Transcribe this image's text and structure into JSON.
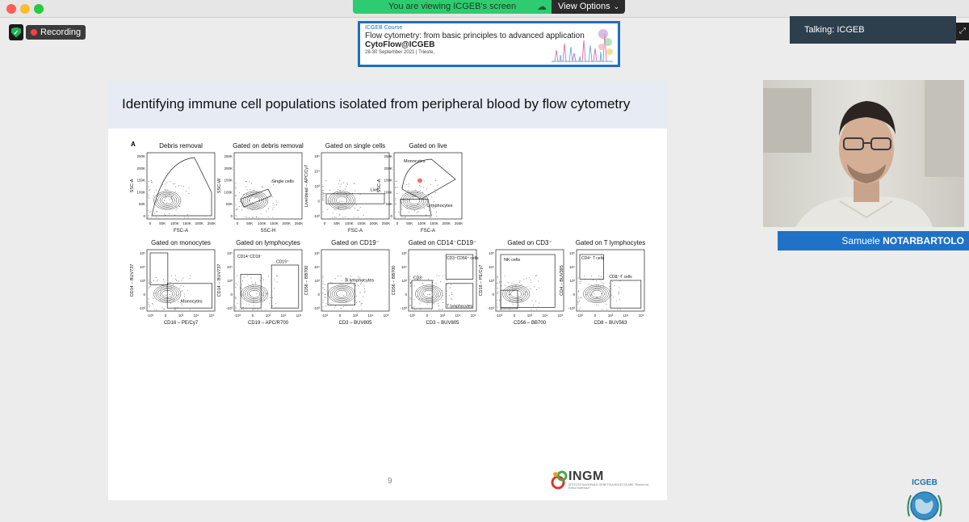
{
  "banner": {
    "viewing_text": "You are viewing ICGEB's screen",
    "view_options_label": "View Options"
  },
  "recording": {
    "label": "Recording"
  },
  "course_logo": {
    "line1": "ICGEB Course",
    "line2": "Flow cytometry: from basic principles to advanced application",
    "line3": "CytoFlow@ICGEB",
    "line4": "28-30 September 2021 | Trieste,"
  },
  "talking": {
    "label": "Talking: ICGEB"
  },
  "slide": {
    "title": "Identifying immune cell populations isolated from peripheral blood by flow cytometry",
    "page_number": "9",
    "logo_text": "INGM",
    "logo_subtext": "ISTITUTO NAZIONALE GENETICA MOLECOLARE \"Romeo ed Enrica Invernizzi\"",
    "figure": {
      "panel_letter": "A",
      "row1": [
        {
          "title": "Debris removal",
          "xlabel": "FSC-A",
          "ylabel": "SSC-A",
          "yticks": [
            "250K",
            "200K",
            "150K",
            "100K",
            "50K",
            "0"
          ],
          "xticks": [
            "0",
            "50K",
            "100K",
            "150K",
            "200K",
            "250K"
          ],
          "gate": ""
        },
        {
          "title": "Gated on debris removal",
          "xlabel": "SSC-H",
          "ylabel": "SSC-W",
          "yticks": [
            "250K",
            "200K",
            "150K",
            "100K",
            "50K",
            "0"
          ],
          "xticks": [
            "0",
            "50K",
            "100K",
            "150K",
            "200K",
            "250K"
          ],
          "gate": "Single cells"
        },
        {
          "title": "Gated on single cells",
          "xlabel": "FSC-A",
          "ylabel": "Live/dead – APC/Cy7",
          "yticks": [
            "10⁵",
            "10⁴",
            "10³",
            "0",
            "-10³"
          ],
          "xticks": [
            "0",
            "50K",
            "100K",
            "150K",
            "200K",
            "250K"
          ],
          "gate": "Live"
        },
        {
          "title": "Gated on live",
          "xlabel": "FSC-A",
          "ylabel": "SSC-A",
          "yticks": [
            "250K",
            "200K",
            "150K",
            "100K",
            "50K",
            "0"
          ],
          "xticks": [
            "0",
            "50K",
            "100K",
            "150K",
            "200K",
            "250K"
          ],
          "gate": "Monocytes",
          "gate2": "Lymphocytes"
        }
      ],
      "row2": [
        {
          "title": "Gated on monocytes",
          "xlabel": "CD16 – PE/Cy7",
          "ylabel": "CD14 – BUV737",
          "yticks": [
            "10⁵",
            "10⁴",
            "10³",
            "0",
            "-10³"
          ],
          "xticks": [
            "-10³",
            "0",
            "10³",
            "10⁴",
            "10⁵"
          ],
          "gate": "Monocytes"
        },
        {
          "title": "Gated on lymphocytes",
          "xlabel": "CD19 – APC/R700",
          "ylabel": "CD14 – BUV737",
          "yticks": [
            "10⁵",
            "10⁴",
            "10³",
            "0",
            "-10³"
          ],
          "xticks": [
            "-10³",
            "0",
            "10³",
            "10⁴",
            "10⁵"
          ],
          "gate": "CD14⁻CD19⁻",
          "gate2": "CD19⁺"
        },
        {
          "title": "Gated on CD19⁻",
          "xlabel": "CD3 – BUV805",
          "ylabel": "CD56 – BB700",
          "yticks": [
            "10⁵",
            "10⁴",
            "10³",
            "0",
            "-10³"
          ],
          "xticks": [
            "-10³",
            "0",
            "10³",
            "10⁴",
            "10⁵"
          ],
          "gate": "B lymphocytes"
        },
        {
          "title": "Gated on CD14⁻CD19⁻",
          "xlabel": "CD3 – BUV805",
          "ylabel": "CD56 – BB700",
          "yticks": [
            "10⁵",
            "10⁴",
            "10³",
            "0",
            "-10³"
          ],
          "xticks": [
            "-10³",
            "0",
            "10³",
            "10⁴",
            "10⁵"
          ],
          "gate": "CD3⁺CD56⁺ cells",
          "gate2": "CD3⁻",
          "gate3": "T lymphocytes"
        },
        {
          "title": "Gated on CD3⁻",
          "xlabel": "CD56 – BB700",
          "ylabel": "CD16 – PE/Cy7",
          "yticks": [
            "10⁵",
            "10⁴",
            "10³",
            "0",
            "-10³"
          ],
          "xticks": [
            "-10³",
            "0",
            "10³",
            "10⁴",
            "10⁵"
          ],
          "gate": "NK cells"
        },
        {
          "title": "Gated on T lymphocytes",
          "xlabel": "CD8 – BUV563",
          "ylabel": "CD4 – BUV395",
          "yticks": [
            "10⁵",
            "10⁴",
            "10³",
            "0",
            "-10³"
          ],
          "xticks": [
            "-10³",
            "0",
            "10³",
            "10⁴",
            "10⁵"
          ],
          "gate": "CD4⁺ T cells",
          "gate2": "CD8⁺ T cells"
        }
      ]
    }
  },
  "participant": {
    "first_name": "Samuele",
    "last_name": "NOTARBARTOLO"
  },
  "seal": {
    "text": "ICGEB"
  },
  "colors": {
    "banner_green": "#2ecc71",
    "nameplate_blue": "#1f72c8",
    "talking_bg": "#2d3e4c",
    "slide_header": "#e7ebf4"
  }
}
